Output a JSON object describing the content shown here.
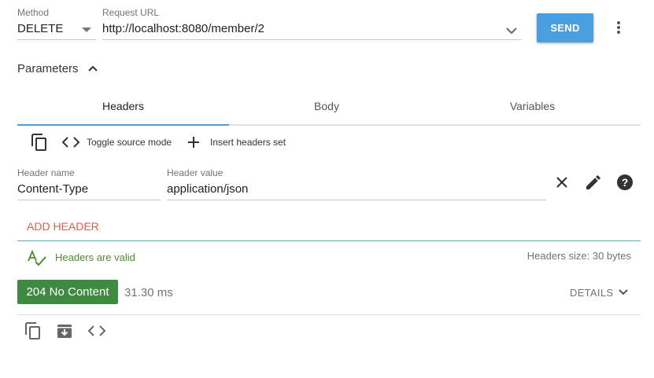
{
  "request": {
    "method_label": "Method",
    "method_value": "DELETE",
    "url_label": "Request URL",
    "url_value": "http://localhost:8080/member/2",
    "send_label": "SEND"
  },
  "parameters": {
    "title": "Parameters",
    "tabs": [
      {
        "label": "Headers",
        "active": true
      },
      {
        "label": "Body",
        "active": false
      },
      {
        "label": "Variables",
        "active": false
      }
    ]
  },
  "headers_toolbar": {
    "toggle_source_label": "Toggle source mode",
    "insert_set_label": "Insert headers set"
  },
  "header_row": {
    "name_label": "Header name",
    "name_value": "Content-Type",
    "value_label": "Header value",
    "value_value": "application/json"
  },
  "add_header_label": "ADD HEADER",
  "validation": {
    "message": "Headers are valid",
    "size_text": "Headers size: 30 bytes"
  },
  "response": {
    "status_text": "204 No Content",
    "time_text": "31.30 ms",
    "details_label": "DETAILS"
  },
  "colors": {
    "accent": "#4a9ede",
    "success": "#3f8a41",
    "add_header": "#e25a4b",
    "valid_text": "#4f8a30"
  }
}
